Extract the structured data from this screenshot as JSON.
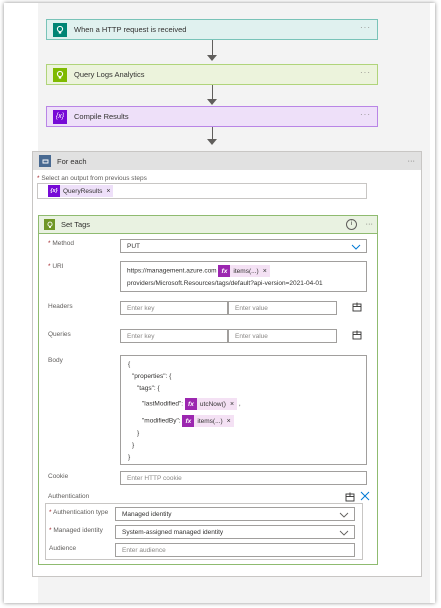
{
  "steps": [
    {
      "label": "When a HTTP request is received",
      "icon": "http-request-icon",
      "color": "#008575",
      "bg": "#e0f1ef",
      "border": "#79c3b8"
    },
    {
      "label": "Query Logs Analytics",
      "icon": "lightbulb-icon",
      "color": "#7fba00",
      "bg": "#ecf3dc",
      "border": "#b0d47a"
    },
    {
      "label": "Compile Results",
      "icon": "variable-icon",
      "color": "#770bd6",
      "bg": "#eee0f9",
      "border": "#b985e6"
    }
  ],
  "more": "···",
  "foreach": {
    "title": "For each",
    "select_label": "Select an output from previous steps",
    "required_mark": "*",
    "token": "QueryResults",
    "token_close": "×"
  },
  "settags": {
    "title": "Set Tags",
    "info": "i",
    "method_label": "Method",
    "method_value": "PUT",
    "uri_label": "URI",
    "uri_line1": "https://management.azure.com",
    "uri_token": "items(...)",
    "uri_line2": "providers/Microsoft.Resources/tags/default?api-version=2021-04-01",
    "headers_label": "Headers",
    "key_placeholder": "Enter key",
    "value_placeholder": "Enter value",
    "queries_label": "Queries",
    "body_label": "Body",
    "body_lines": [
      "{",
      "\"properties\": {",
      "\"tags\": {",
      "\"lastModified\":",
      "\"modifiedBy\":",
      "}",
      "}",
      "}"
    ],
    "body_token_1": "utcNow()",
    "body_token_2": "items(...)",
    "body_sep": ",",
    "cookie_label": "Cookie",
    "cookie_placeholder": "Enter HTTP cookie",
    "auth_label": "Authentication",
    "auth_type_label": "Authentication type",
    "auth_type_value": "Managed identity",
    "managed_identity_label": "Managed identity",
    "managed_identity_value": "System-assigned managed identity",
    "audience_label": "Audience",
    "audience_placeholder": "Enter audience"
  },
  "fx": "fx",
  "token_close": "×"
}
